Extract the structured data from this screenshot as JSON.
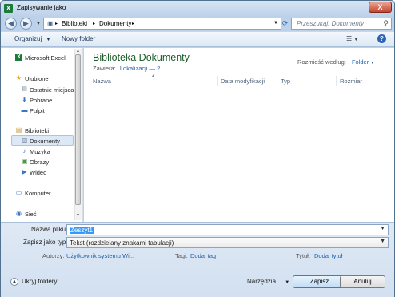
{
  "window": {
    "title": "Zapisywanie jako",
    "app_icon": "excel-icon",
    "close_label": "X"
  },
  "address": {
    "segments": [
      "Biblioteki",
      "Dokumenty"
    ],
    "search_placeholder": "Przeszukaj: Dokumenty"
  },
  "toolbar": {
    "organize_label": "Organizuj",
    "new_folder_label": "Nowy folder",
    "help_label": "?"
  },
  "nav": {
    "items": [
      {
        "label": "Microsoft Excel",
        "icon": "excel-icon"
      },
      {
        "label": "Ulubione",
        "icon": "star-icon"
      },
      {
        "label": "Ostatnie miejsca",
        "icon": "recent-places-icon"
      },
      {
        "label": "Pobrane",
        "icon": "downloads-icon"
      },
      {
        "label": "Pulpit",
        "icon": "desktop-icon"
      },
      {
        "label": "Biblioteki",
        "icon": "libraries-icon"
      },
      {
        "label": "Dokumenty",
        "icon": "documents-icon"
      },
      {
        "label": "Muzyka",
        "icon": "music-icon"
      },
      {
        "label": "Obrazy",
        "icon": "pictures-icon"
      },
      {
        "label": "Wideo",
        "icon": "video-icon"
      },
      {
        "label": "Komputer",
        "icon": "computer-icon"
      },
      {
        "label": "Sieć",
        "icon": "network-icon"
      }
    ],
    "selected": "Dokumenty"
  },
  "library": {
    "title": "Biblioteka Dokumenty",
    "contains_label": "Zawiera:",
    "locations_link": "Lokalizacji — 2",
    "arrange_label": "Rozmieść według:",
    "arrange_value": "Folder"
  },
  "columns": [
    "Nazwa",
    "Data modyfikacji",
    "Typ",
    "Rozmiar"
  ],
  "form": {
    "filename_label": "Nazwa pliku:",
    "filename_value": "Zeszyt1",
    "filetype_label": "Zapisz jako typ:",
    "filetype_value": "Tekst (rozdzielany znakami tabulacji)",
    "authors_label": "Autorzy:",
    "authors_value": "Użytkownik systemu Wi...",
    "tags_label": "Tagi:",
    "tags_value": "Dodaj tag",
    "title_label": "Tytuł:",
    "title_value": "Dodaj tytuł"
  },
  "footer": {
    "hide_folders_label": "Ukryj foldery",
    "tools_label": "Narzędzia",
    "save_label": "Zapisz",
    "cancel_label": "Anuluj"
  },
  "colors": {
    "library_title": "#1e5d2b",
    "link": "#1f5ea8",
    "selection": "#3399ff",
    "excel_green": "#1d7a3a"
  }
}
